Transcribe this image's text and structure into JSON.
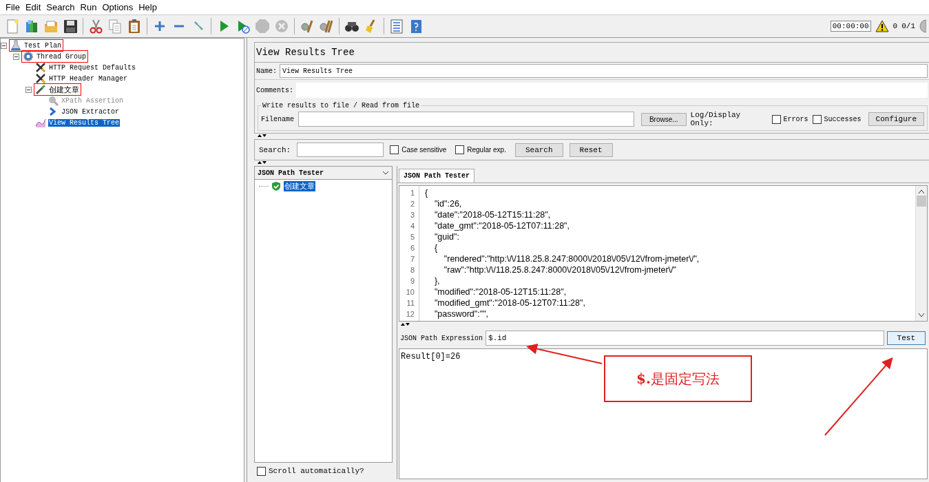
{
  "menu": [
    "File",
    "Edit",
    "Search",
    "Run",
    "Options",
    "Help"
  ],
  "status": {
    "timer": "00:00:00",
    "warnings": "0",
    "threads": "0/1"
  },
  "tree": [
    {
      "label": "Test Plan",
      "kind": "plan",
      "marked": true,
      "selected": false,
      "disabled": false,
      "expanded": true,
      "children": [
        {
          "label": "Thread Group",
          "kind": "threads",
          "marked": true,
          "selected": false,
          "disabled": false,
          "expanded": true,
          "children": [
            {
              "label": "HTTP Request Defaults",
              "kind": "config",
              "marked": false,
              "selected": false,
              "disabled": false
            },
            {
              "label": "HTTP Header Manager",
              "kind": "config",
              "marked": false,
              "selected": false,
              "disabled": false
            },
            {
              "label": "创建文章",
              "kind": "sampler",
              "marked": true,
              "selected": false,
              "disabled": false,
              "expanded": true,
              "children": [
                {
                  "label": "XPath Assertion",
                  "kind": "assertion",
                  "marked": false,
                  "selected": false,
                  "disabled": true
                },
                {
                  "label": "JSON Extractor",
                  "kind": "extractor",
                  "marked": false,
                  "selected": false,
                  "disabled": false
                }
              ]
            },
            {
              "label": "View Results Tree",
              "kind": "listener",
              "marked": false,
              "selected": true,
              "disabled": false
            }
          ]
        }
      ]
    }
  ],
  "panel": {
    "title": "View Results Tree",
    "name_label": "Name:",
    "name_value": "View Results Tree",
    "comments_label": "Comments:",
    "file_group": {
      "legend": "Write results to file / Read from file",
      "filename_label": "Filename",
      "browse": "Browse...",
      "log_label": "Log/Display Only:",
      "checkboxes": [
        {
          "label": "Errors",
          "checked": false
        },
        {
          "label": "Successes",
          "checked": false
        }
      ],
      "configure": "Configure"
    },
    "search": {
      "label": "Search:",
      "options": [
        {
          "label": "Case sensitive",
          "checked": false
        },
        {
          "label": "Regular exp.",
          "checked": false
        }
      ],
      "buttons": [
        "Search",
        "Reset"
      ]
    }
  },
  "results": {
    "renderer": "JSON Path Tester",
    "items": [
      {
        "label": "创建文章",
        "passed": true,
        "selected": true
      }
    ],
    "scroll_auto": {
      "label": "Scroll automatically?",
      "checked": false
    }
  },
  "tester": {
    "tabs": [
      {
        "label": "JSON Path Tester",
        "selected": true
      }
    ],
    "code_lines": [
      {
        "number": "1",
        "text": "{"
      },
      {
        "number": "2",
        "text": "    \"id\":26,"
      },
      {
        "number": "3",
        "text": "    \"date\":\"2018-05-12T15:11:28\","
      },
      {
        "number": "4",
        "text": "    \"date_gmt\":\"2018-05-12T07:11:28\","
      },
      {
        "number": "5",
        "text": "    \"guid\":"
      },
      {
        "number": "6",
        "text": "    {"
      },
      {
        "number": "7",
        "text": "        \"rendered\":\"http:\\/\\/118.25.8.247:8000\\/2018\\/05\\/12\\/from-jmeter\\/\","
      },
      {
        "number": "8",
        "text": "        \"raw\":\"http:\\/\\/118.25.8.247:8000\\/2018\\/05\\/12\\/from-jmeter\\/\""
      },
      {
        "number": "9",
        "text": "    },"
      },
      {
        "number": "10",
        "text": "    \"modified\":\"2018-05-12T15:11:28\","
      },
      {
        "number": "11",
        "text": "    \"modified_gmt\":\"2018-05-12T07:11:28\","
      },
      {
        "number": "12",
        "text": "    \"password\":\"\","
      }
    ],
    "expression_label": "JSON Path Expression",
    "expression": "$.id",
    "test_button": "Test",
    "result": "Result[0]=26"
  },
  "annotation": {
    "text": "**$.**是固定写法"
  }
}
